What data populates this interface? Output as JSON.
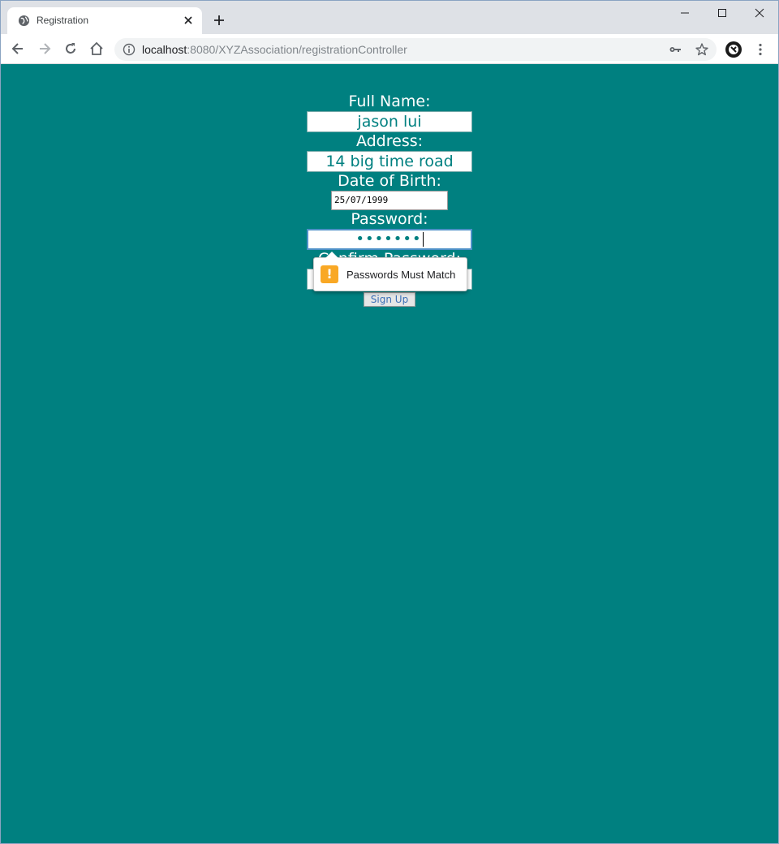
{
  "browser": {
    "tab_title": "Registration",
    "url_host": "localhost",
    "url_rest": ":8080/XYZAssociation/registrationController"
  },
  "form": {
    "full_name_label": "Full Name:",
    "full_name_value": "jason lui",
    "address_label": "Address:",
    "address_value": "14 big time road",
    "dob_label": "Date of Birth:",
    "dob_value": "25/07/1999",
    "password_label": "Password:",
    "password_masked": "•••••••",
    "confirm_label": "Confirm Password:",
    "signup_label": "Sign Up"
  },
  "validation": {
    "message": "Passwords Must Match"
  },
  "colors": {
    "page_background": "#008080",
    "warning": "#f9a825"
  }
}
